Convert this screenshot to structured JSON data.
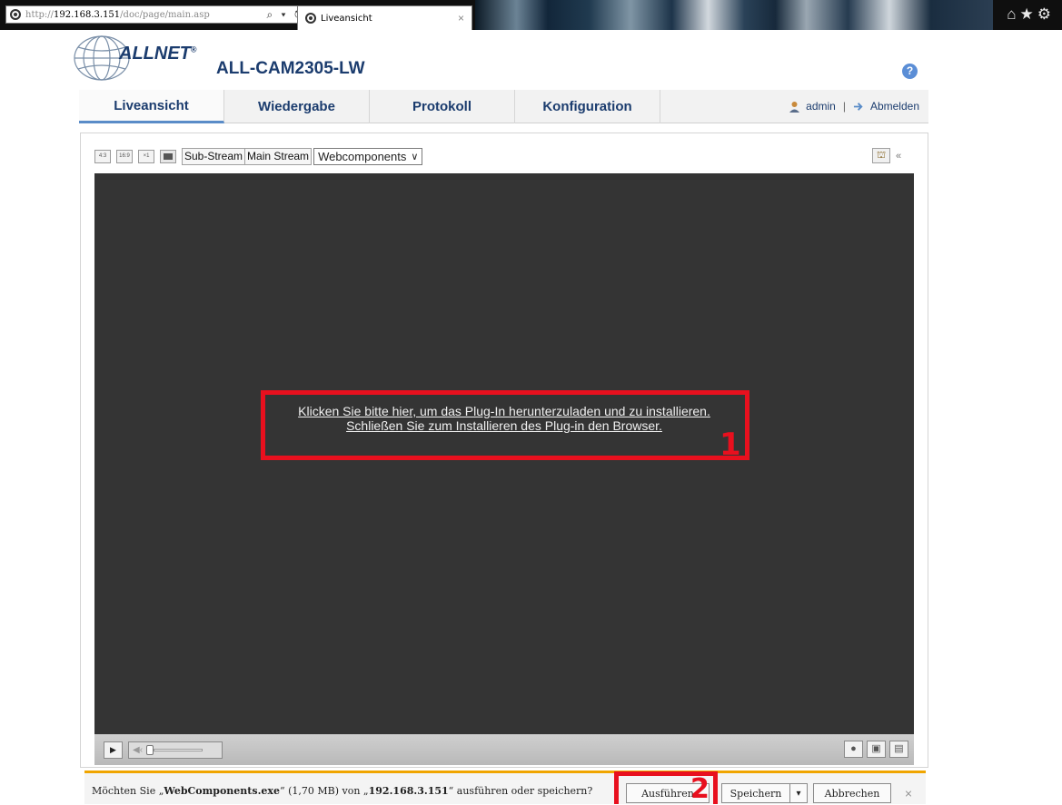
{
  "browser": {
    "url_prefix": "http://",
    "url_host": "192.168.3.151",
    "url_path": "/doc/page/main.asp",
    "address_controls": "⌕ ▾ ↻",
    "tab_title": "Liveansicht",
    "tab_close": "×",
    "icons": "⌂★⚙"
  },
  "header": {
    "logo_text": "ALLNET",
    "logo_mark": "®",
    "model": "ALL-CAM2305-LW",
    "help": "?"
  },
  "nav": {
    "tabs": [
      {
        "label": "Liveansicht",
        "active": true
      },
      {
        "label": "Wiedergabe",
        "active": false
      },
      {
        "label": "Protokoll",
        "active": false
      },
      {
        "label": "Konfiguration",
        "active": false
      }
    ],
    "user": "admin",
    "separator": "|",
    "logout": "Abmelden"
  },
  "toolbar": {
    "ratios": [
      "4:3",
      "16:9",
      "×1"
    ],
    "substream": "Sub-Stream",
    "mainstream": "Main Stream",
    "plugin_select": "Webcomponents",
    "collapse": "«"
  },
  "video": {
    "plugin_line1": "Klicken Sie bitte hier, um das Plug-In herunterzuladen und zu installieren.",
    "plugin_line2": "Schließen Sie zum Installieren des Plug-in den Browser.",
    "marker1": "1"
  },
  "controls": {
    "play": "▶",
    "speaker": "◀‹",
    "right_icons": [
      "🎙",
      "▣",
      "▤"
    ]
  },
  "download": {
    "msg_prefix": "Möchten Sie „",
    "file": "WebComponents.exe",
    "msg_mid": "“ (1,70 MB) von „",
    "host": "192.168.3.151",
    "msg_suffix": "“ ausführen oder speichern?",
    "run": "Ausführen",
    "save": "Speichern",
    "save_arrow": "▾",
    "cancel": "Abbrechen",
    "close": "×",
    "marker2": "2"
  },
  "colors": {
    "brand": "#1b3c6e",
    "highlight": "#e8101e",
    "notification_accent": "#f0a500"
  }
}
